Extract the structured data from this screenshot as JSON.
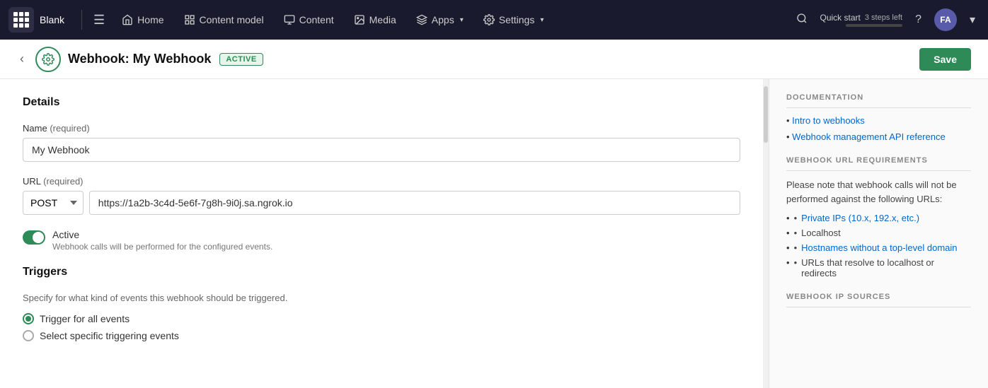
{
  "app": {
    "name": "Blank"
  },
  "topnav": {
    "brand": "Blank",
    "menu_icon": "☰",
    "items": [
      {
        "id": "home",
        "label": "Home",
        "icon": "home"
      },
      {
        "id": "content-model",
        "label": "Content model",
        "icon": "content-model"
      },
      {
        "id": "content",
        "label": "Content",
        "icon": "content"
      },
      {
        "id": "media",
        "label": "Media",
        "icon": "media"
      },
      {
        "id": "apps",
        "label": "Apps",
        "icon": "apps",
        "hasChevron": true
      },
      {
        "id": "settings",
        "label": "Settings",
        "icon": "settings",
        "hasChevron": true
      }
    ],
    "quick_start": {
      "label": "Quick start",
      "steps_left": "3 steps left"
    },
    "avatar_initials": "FA"
  },
  "page": {
    "title": "Webhook: My Webhook",
    "badge": "ACTIVE",
    "save_button": "Save"
  },
  "form": {
    "details_label": "Details",
    "name_label": "Name",
    "name_required": "(required)",
    "name_value": "My Webhook",
    "url_label": "URL",
    "url_required": "(required)",
    "url_method": "POST",
    "url_value": "https://1a2b-3c4d-5e6f-7g8h-9i0j.sa.ngrok.io",
    "active_label": "Active",
    "active_hint": "Webhook calls will be performed for the configured events.",
    "triggers_label": "Triggers",
    "triggers_desc": "Specify for what kind of events this webhook should be triggered.",
    "trigger_all_label": "Trigger for all events",
    "trigger_specific_label": "Select specific triggering events"
  },
  "docs": {
    "documentation_title": "DOCUMENTATION",
    "links": [
      {
        "label": "Intro to webhooks",
        "url": "#"
      },
      {
        "label": "Webhook management API reference",
        "url": "#"
      }
    ],
    "url_requirements_title": "WEBHOOK URL REQUIREMENTS",
    "url_requirements_text": "Please note that webhook calls will not be performed against the following URLs:",
    "url_requirements_items": [
      {
        "text": "Private IPs (10.x, 192.x, etc.)"
      },
      {
        "text": "Localhost"
      },
      {
        "text": "Hostnames without a top-level domain"
      },
      {
        "text": "URLs that resolve to localhost or redirects"
      }
    ],
    "ip_sources_title": "WEBHOOK IP SOURCES"
  }
}
